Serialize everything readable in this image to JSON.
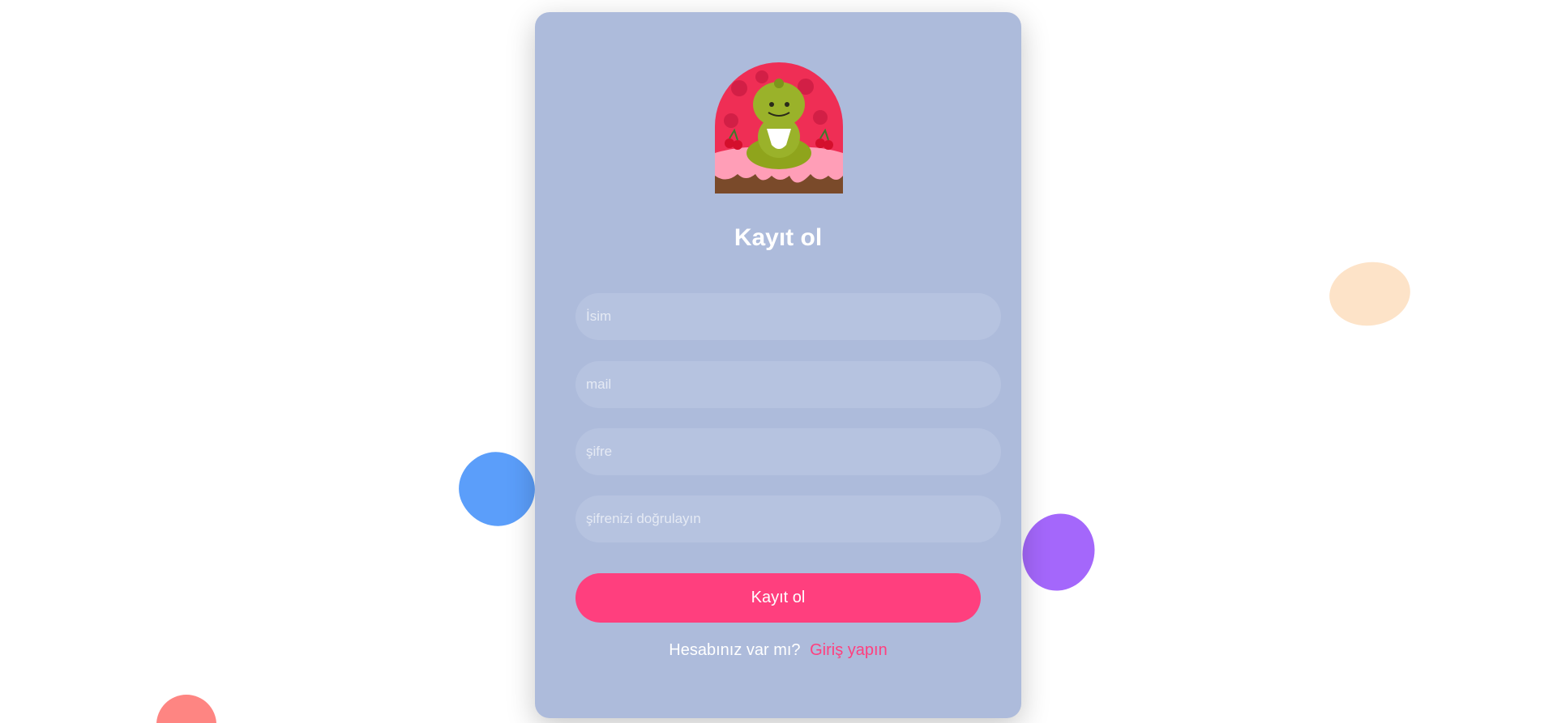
{
  "colors": {
    "card_bg": "#adbbdb",
    "input_bg": "#b6c3e0",
    "accent_pink": "#ff3f7e",
    "link_pink": "#ff3f7e",
    "blob_blue": "#5b9efa",
    "blob_purple": "#a467fb",
    "blob_peach": "#fde3c8",
    "blob_coral": "#fe8582"
  },
  "avatar": {
    "icon": "dinosaur-cake-icon"
  },
  "form": {
    "title": "Kayıt ol",
    "name_placeholder": "İsim",
    "email_placeholder": "mail",
    "password_placeholder": "şifre",
    "confirm_placeholder": "şifrenizi doğrulayın",
    "submit_label": "Kayıt ol"
  },
  "footer": {
    "question": "Hesabınız var mı?",
    "login_link": "Giriş yapın"
  }
}
